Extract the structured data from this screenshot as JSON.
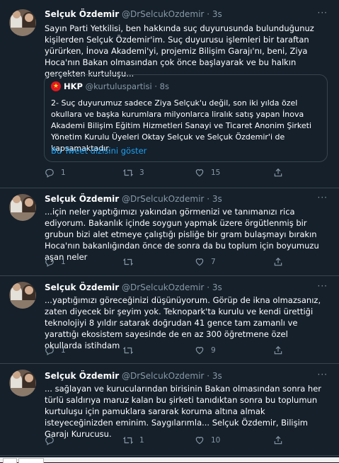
{
  "tweets": [
    {
      "name": "Selçuk Özdemir",
      "handle": "@DrSelcukOzdemir",
      "time": "3s",
      "more": "···",
      "text": "Sayın Parti Yetkilisi, ben hakkında suç duyurusunda bulunduğunuz kişilerden Selçuk Özdemir'im. Suç duyurusu işlemleri bir taraftan yürürken, İnova Akademi'yi, projemiz Bilişim Garajı'nı, beni, Ziya Hoca'nın Bakan olmasından çok önce başlayarak ve bu halkın gerçekten kurtuluşu...",
      "quote": {
        "name": "HKP",
        "handle": "@kurtuluspartisi",
        "time": "8s",
        "text": "2- Suç duyurumuz sadece Ziya Selçuk'u değil, son iki yılda özel okullara ve başka kurumlara milyonlarca liralık satış yapan İnova Akademi Bilişim Eğitim Hizmetleri Sanayi ve Ticaret Anonim Şirketi Yönetim Kurulu Üyeleri Oktay Selçuk ve Selçuk Özdemir'i de kapsamaktadır.",
        "link": "Bu Tweet dizisini göster"
      },
      "replies": "1",
      "retweets": "3",
      "likes": "15"
    },
    {
      "name": "Selçuk Özdemir",
      "handle": "@DrSelcukOzdemir",
      "time": "3s",
      "more": "···",
      "text": "...için neler yaptığımızı yakından görmenizi ve tanımanızı rica ediyorum. Bakanlık içinde soygun yapmak üzere örgütlenmiş bir grubun bizi alet etmeye çalıştığı pisliğe bir gram bulaşmayı bırakın Hoca'nın bakanlığından önce de sonra da bu toplum için boyumuzu aşan neler",
      "replies": "1",
      "retweets": "",
      "likes": "7"
    },
    {
      "name": "Selçuk Özdemir",
      "handle": "@DrSelcukOzdemir",
      "time": "3s",
      "more": "···",
      "text": "...yaptığımızı göreceğinizi düşünüyorum. Görüp de ikna olmazsanız, zaten diyecek bir şeyim yok. Teknopark'ta kurulu ve kendi ürettiği teknolojiyi 8 yıldır satarak doğrudan 41 gence tam zamanlı ve yarattığı ekosistem sayesinde de en az 300 öğretmene özel okullarda istihdam",
      "replies": "1",
      "retweets": "",
      "likes": "9"
    },
    {
      "name": "Selçuk Özdemir",
      "handle": "@DrSelcukOzdemir",
      "time": "3s",
      "more": "···",
      "text": "... sağlayan ve kurucularından birisinin Bakan olmasından sonra her türlü saldırıya maruz kalan bu şirketi tanıdıktan sonra bu toplumun kurtuluşu için pamuklara sararak koruma altına almak isteyeceğinizden eminim. Saygılarımla... Selçuk Özdemir, Bilişim Garajı Kurucusu.",
      "replies": "",
      "retweets": "1",
      "likes": "10"
    }
  ],
  "colors": {
    "background": "#15202b",
    "border": "#38444d",
    "secondary_text": "#8899a6",
    "link": "#1da1f2"
  },
  "icons": {
    "reply": "reply-icon",
    "retweet": "retweet-icon",
    "like": "heart-icon",
    "share": "share-icon",
    "more": "more-icon"
  }
}
